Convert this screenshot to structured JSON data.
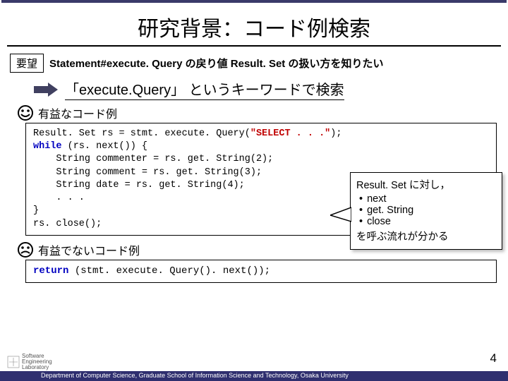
{
  "title": "研究背景：コード例検索",
  "request": {
    "badge": "要望",
    "text": "Statement#execute. Query の戻り値 Result. Set の扱い方を知りたい"
  },
  "search_line": "「execute.Query」 というキーワードで検索",
  "good_label": "有益なコード例",
  "bad_label": "有益でないコード例",
  "code_good": {
    "l1a": "Result. Set rs = stmt. execute. Query(",
    "l1b": "\"SELECT . . .\"",
    "l1c": ");",
    "l2a": "while",
    "l2b": " (rs. next()) {",
    "l3": "    String commenter = rs. get. String(2);",
    "l4": "    String comment = rs. get. String(3);",
    "l5": "    String date = rs. get. String(4);",
    "l6": "    . . .",
    "l7": "}",
    "l8": "rs. close();"
  },
  "code_bad": {
    "kw": "return",
    "rest": " (stmt. execute. Query(). next());"
  },
  "callout": {
    "head": "Result. Set に対し，",
    "items": [
      "next",
      "get. String",
      "close"
    ],
    "tail": "を呼ぶ流れが分かる"
  },
  "page": "4",
  "footer_text": "Department of Computer Science, Graduate School of Information Science and Technology, Osaka University",
  "logo": {
    "l1": "Software",
    "l2": "Engineering",
    "l3": "Laboratory"
  }
}
